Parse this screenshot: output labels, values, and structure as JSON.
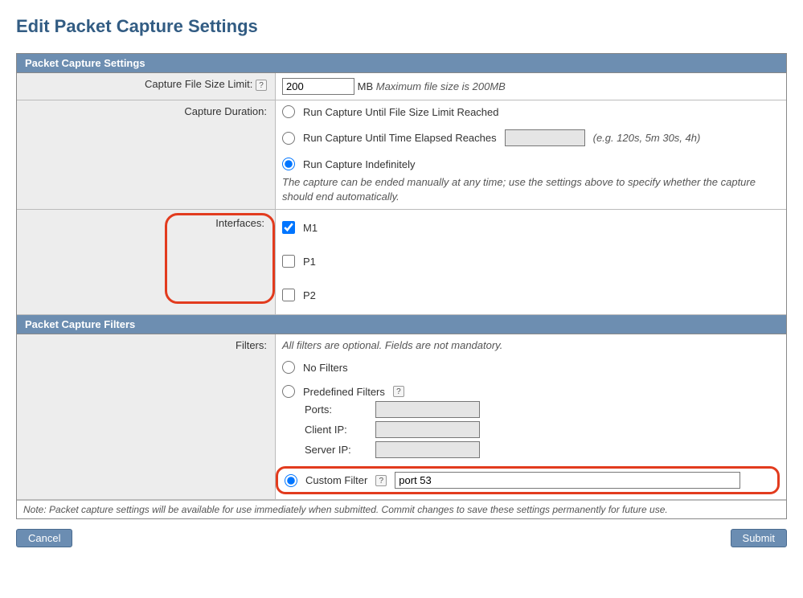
{
  "title": "Edit Packet Capture Settings",
  "settings_header": "Packet Capture Settings",
  "filters_header": "Packet Capture Filters",
  "labels": {
    "file_size": "Capture File Size Limit:",
    "duration": "Capture Duration:",
    "interfaces": "Interfaces:",
    "filters": "Filters:"
  },
  "file_size": {
    "value": "200",
    "unit": "MB",
    "note": "Maximum file size is 200MB"
  },
  "duration": {
    "opt1": "Run Capture Until File Size Limit Reached",
    "opt2": "Run Capture Until Time Elapsed Reaches",
    "opt2_hint": "(e.g. 120s, 5m 30s, 4h)",
    "opt3": "Run Capture Indefinitely",
    "note": "The capture can be ended manually at any time; use the settings above to specify whether the capture should end automatically."
  },
  "interfaces": {
    "m1": "M1",
    "p1": "P1",
    "p2": "P2"
  },
  "filters": {
    "intro": "All filters are optional. Fields are not mandatory.",
    "none": "No Filters",
    "predefined": "Predefined Filters",
    "ports": "Ports:",
    "client_ip": "Client IP:",
    "server_ip": "Server IP:",
    "custom": "Custom Filter",
    "custom_value": "port 53"
  },
  "footer_note": "Note: Packet capture settings will be available for use immediately when submitted. Commit changes to save these settings permanently for future use.",
  "buttons": {
    "cancel": "Cancel",
    "submit": "Submit"
  },
  "help_glyph": "?"
}
